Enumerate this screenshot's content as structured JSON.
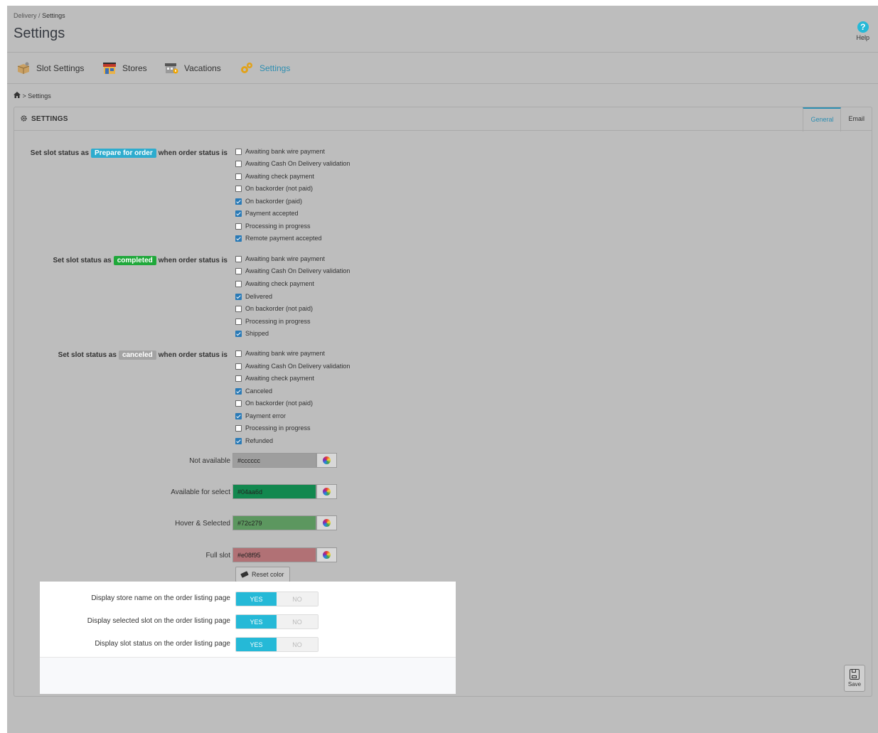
{
  "breadcrumb_top": {
    "parent": "Delivery",
    "separator": "/",
    "current": "Settings"
  },
  "page": {
    "title": "Settings",
    "help_label": "Help",
    "help_glyph": "?"
  },
  "nav": [
    {
      "label": "Slot Settings",
      "icon": "box-icon"
    },
    {
      "label": "Stores",
      "icon": "store-icon"
    },
    {
      "label": "Vacations",
      "icon": "vacation-store-icon"
    },
    {
      "label": "Settings",
      "icon": "gears-icon",
      "active": true
    }
  ],
  "crumb": {
    "home_icon": "home-icon",
    "text": "> Settings"
  },
  "panel": {
    "title": "SETTINGS",
    "tabs": [
      {
        "label": "General",
        "active": true
      },
      {
        "label": "Email"
      }
    ]
  },
  "groups": [
    {
      "prefix": "Set slot status as",
      "badge": "Prepare for order",
      "badge_color": "#2eacce",
      "suffix": "when order status is",
      "options": [
        {
          "label": "Awaiting bank wire payment",
          "checked": false
        },
        {
          "label": "Awaiting Cash On Delivery validation",
          "checked": false
        },
        {
          "label": "Awaiting check payment",
          "checked": false
        },
        {
          "label": "On backorder (not paid)",
          "checked": false
        },
        {
          "label": "On backorder (paid)",
          "checked": true
        },
        {
          "label": "Payment accepted",
          "checked": true
        },
        {
          "label": "Processing in progress",
          "checked": false
        },
        {
          "label": "Remote payment accepted",
          "checked": true
        }
      ]
    },
    {
      "prefix": "Set slot status as",
      "badge": "completed",
      "badge_color": "#1fa83a",
      "suffix": "when order status is",
      "options": [
        {
          "label": "Awaiting bank wire payment",
          "checked": false
        },
        {
          "label": "Awaiting Cash On Delivery validation",
          "checked": false
        },
        {
          "label": "Awaiting check payment",
          "checked": false
        },
        {
          "label": "Delivered",
          "checked": true
        },
        {
          "label": "On backorder (not paid)",
          "checked": false
        },
        {
          "label": "Processing in progress",
          "checked": false
        },
        {
          "label": "Shipped",
          "checked": true
        }
      ]
    },
    {
      "prefix": "Set slot status as",
      "badge": "canceled",
      "badge_color": "#a3a3a3",
      "suffix": "when order status is",
      "options": [
        {
          "label": "Awaiting bank wire payment",
          "checked": false
        },
        {
          "label": "Awaiting Cash On Delivery validation",
          "checked": false
        },
        {
          "label": "Awaiting check payment",
          "checked": false
        },
        {
          "label": "Canceled",
          "checked": true
        },
        {
          "label": "On backorder (not paid)",
          "checked": false
        },
        {
          "label": "Payment error",
          "checked": true
        },
        {
          "label": "Processing in progress",
          "checked": false
        },
        {
          "label": "Refunded",
          "checked": true
        }
      ]
    }
  ],
  "colors": [
    {
      "label": "Not available",
      "value": "#cccccc",
      "swatch": "#9e9e9e"
    },
    {
      "label": "Available for select",
      "value": "#04aa6d",
      "swatch": "#12884f"
    },
    {
      "label": "Hover & Selected",
      "value": "#72c279",
      "swatch": "#5c975f"
    },
    {
      "label": "Full slot",
      "value": "#e08f95",
      "swatch": "#b17175"
    }
  ],
  "reset_label": "Reset color",
  "switches": [
    {
      "label": "Display store name on the order listing page",
      "yes": "YES",
      "no": "NO",
      "value": "YES"
    },
    {
      "label": "Display selected slot on the order listing page",
      "yes": "YES",
      "no": "NO",
      "value": "YES"
    },
    {
      "label": "Display slot status on the order listing page",
      "yes": "YES",
      "no": "NO",
      "value": "YES"
    }
  ],
  "save_label": "Save"
}
